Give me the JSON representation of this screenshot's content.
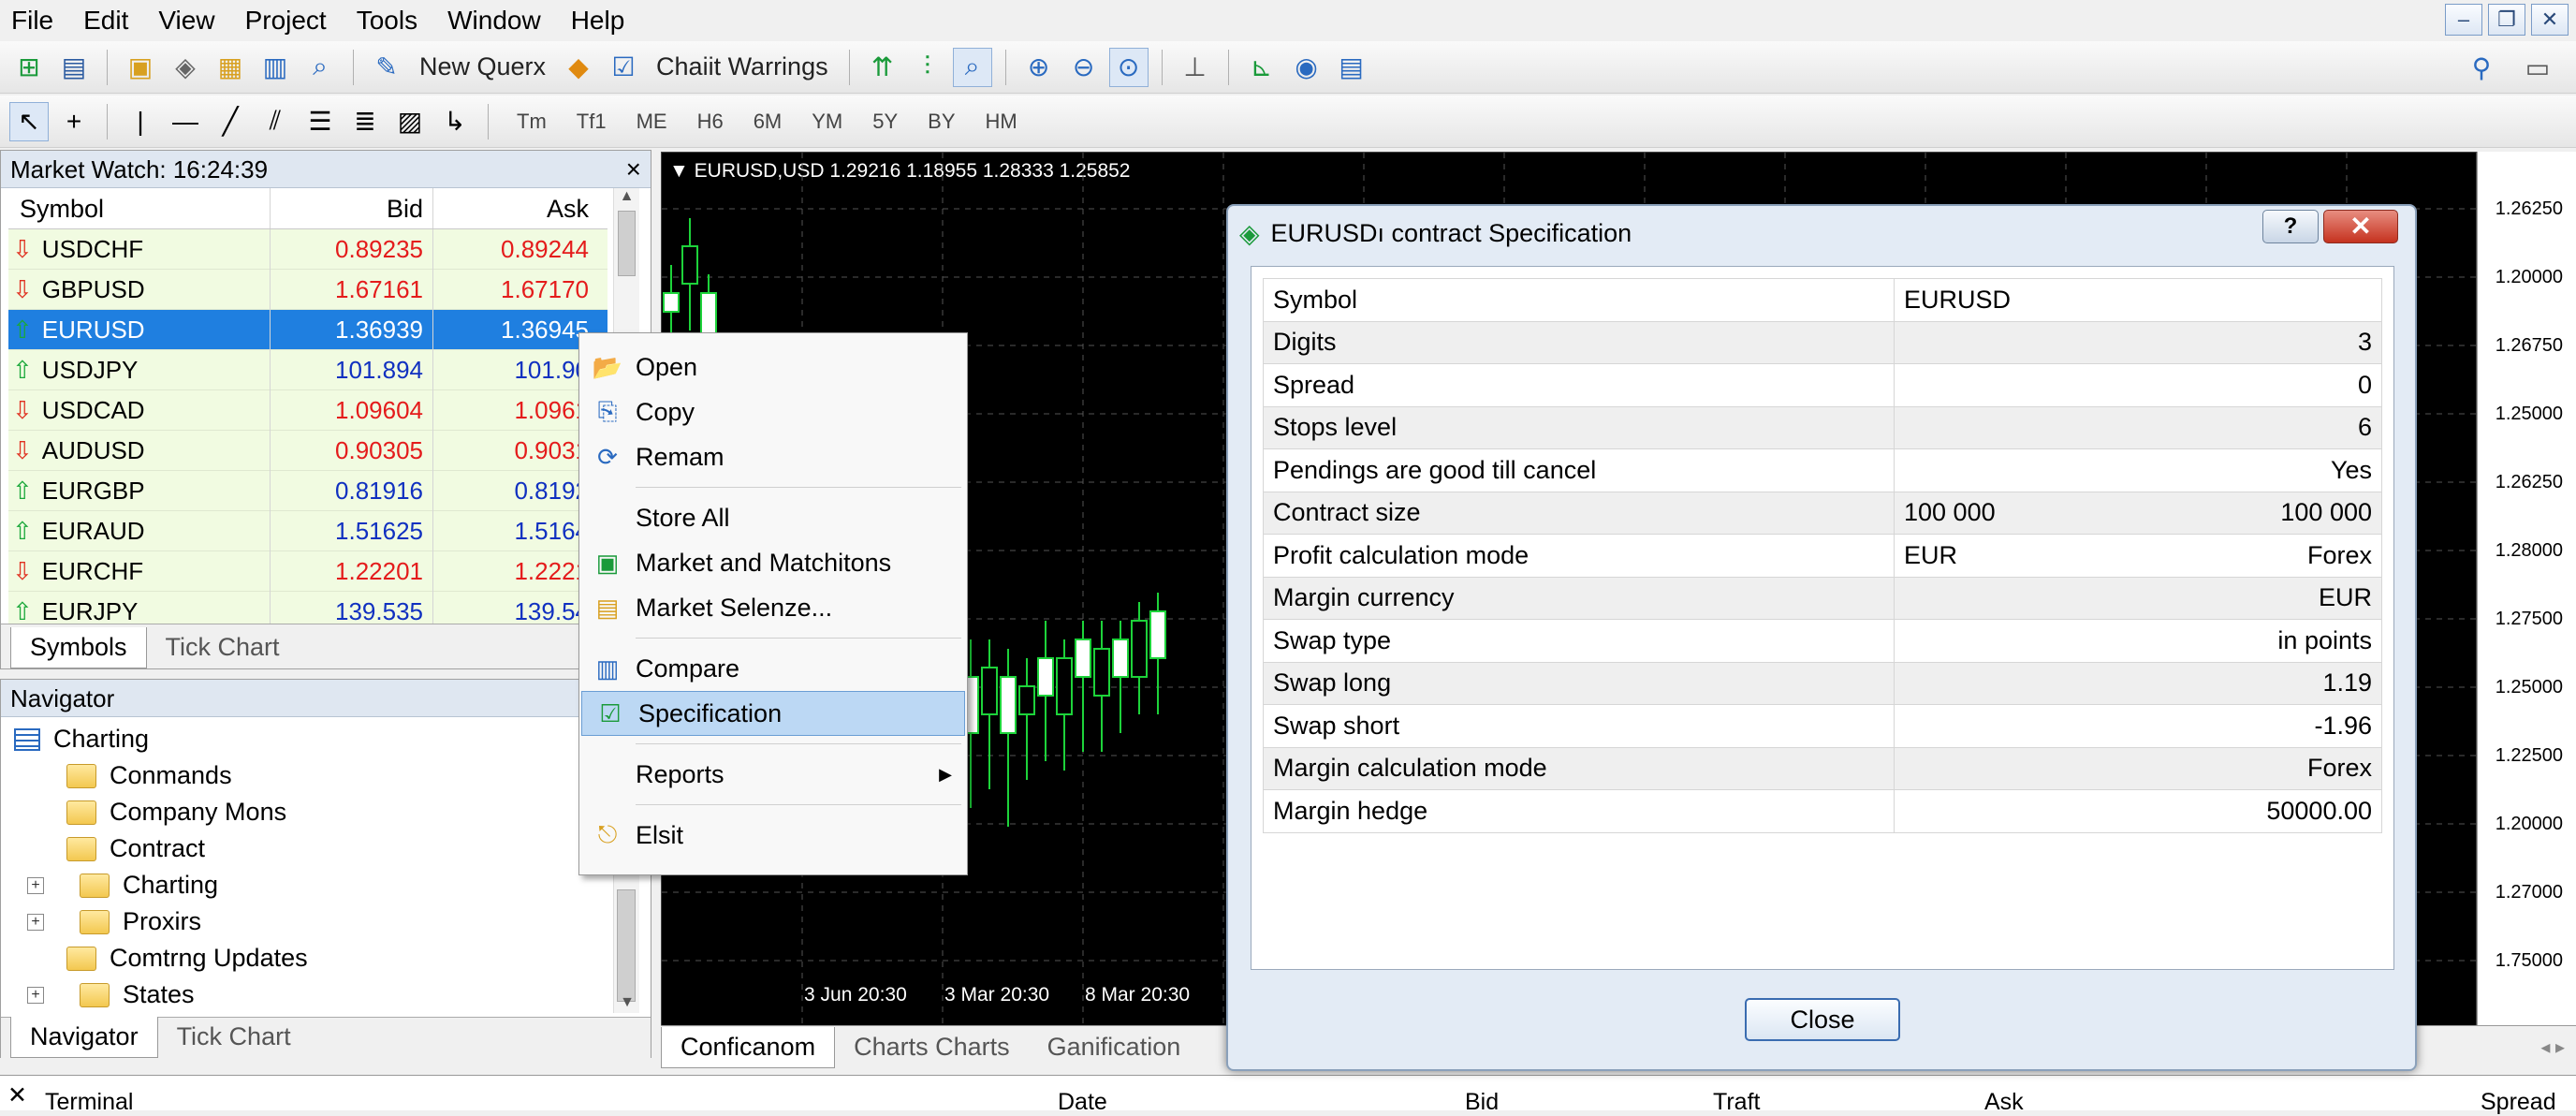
{
  "menubar": {
    "items": [
      "File",
      "Edit",
      "View",
      "Project",
      "Tools",
      "Window",
      "Help"
    ]
  },
  "toolbar1": {
    "new_order": "New Querx",
    "chart_warnings": "Chaiit Warrings"
  },
  "toolbar2": {
    "timeframes": [
      "Tm",
      "Tf1",
      "ME",
      "H6",
      "6M",
      "YM",
      "5Y",
      "BY",
      "HM"
    ]
  },
  "market_watch": {
    "title": "Market Watch: 16:24:39",
    "close": "×",
    "columns": [
      "Symbol",
      "Bid",
      "Ask"
    ],
    "rows": [
      {
        "symbol": "USDCHF",
        "bid": "0.89235",
        "ask": "0.89244",
        "dir": "down",
        "color": "red"
      },
      {
        "symbol": "GBPUSD",
        "bid": "1.67161",
        "ask": "1.67170",
        "dir": "down",
        "color": "red"
      },
      {
        "symbol": "EURUSD",
        "bid": "1.36939",
        "ask": "1.36945",
        "dir": "up",
        "color": "sel"
      },
      {
        "symbol": "USDJPY",
        "bid": "101.894",
        "ask": "101.90",
        "dir": "up",
        "color": "blue"
      },
      {
        "symbol": "USDCAD",
        "bid": "1.09604",
        "ask": "1.0961",
        "dir": "down",
        "color": "red"
      },
      {
        "symbol": "AUDUSD",
        "bid": "0.90305",
        "ask": "0.9031",
        "dir": "down",
        "color": "red"
      },
      {
        "symbol": "EURGBP",
        "bid": "0.81916",
        "ask": "0.8192",
        "dir": "up",
        "color": "blue"
      },
      {
        "symbol": "EURAUD",
        "bid": "1.51625",
        "ask": "1.5164",
        "dir": "up",
        "color": "blue"
      },
      {
        "symbol": "EURCHF",
        "bid": "1.22201",
        "ask": "1.2221",
        "dir": "down",
        "color": "red"
      },
      {
        "symbol": "EURJPY",
        "bid": "139.535",
        "ask": "139.54",
        "dir": "up",
        "color": "blue"
      }
    ],
    "tabs": [
      "Symbols",
      "Tick Chart"
    ]
  },
  "navigator": {
    "title": "Navigator",
    "items": [
      {
        "label": "Charting",
        "level": 0,
        "icon": "chart-list-icon"
      },
      {
        "label": "Conmands",
        "level": 1,
        "icon": "folder-icon"
      },
      {
        "label": "Company Mons",
        "level": 1,
        "icon": "folder-icon"
      },
      {
        "label": "Contract",
        "level": 1,
        "icon": "contract-icon"
      },
      {
        "label": "Charting",
        "level": 1,
        "icon": "chart-icon",
        "expand": true
      },
      {
        "label": "Proxirs",
        "level": 1,
        "icon": "folder-icon",
        "expand": true
      },
      {
        "label": "Comtrng Updates",
        "level": 1,
        "icon": "folder-icon"
      },
      {
        "label": "States",
        "level": 1,
        "icon": "folder-icon",
        "expand": true
      }
    ],
    "tabs": [
      "Navigator",
      "Tick Chart"
    ]
  },
  "chart": {
    "label": "EURUSD,USD",
    "ohlc": "1.29216 1.18955 1.28333 1.25852",
    "price_labels": [
      "1.26250",
      "1.20000",
      "1.26750",
      "1.25000",
      "1.26250",
      "1.28000",
      "1.27500",
      "1.25000",
      "1.22500",
      "1.20000",
      "1.27000",
      "1.75000"
    ],
    "time_labels": [
      "3 Jun 20:30",
      "3 Mar 20:30",
      "8 Mar 20:30"
    ],
    "tabs": [
      "Conficanom",
      "Charts Charts",
      "Ganification"
    ]
  },
  "context_menu": {
    "items": [
      {
        "label": "Open",
        "icon": "folder-open-icon"
      },
      {
        "label": "Copy",
        "icon": "copy-icon"
      },
      {
        "label": "Remam",
        "icon": "refresh-icon"
      },
      {
        "sep": true
      },
      {
        "label": "Store All",
        "icon": ""
      },
      {
        "label": "Market and Matchitons",
        "icon": "market-icon"
      },
      {
        "label": "Market Selenze...",
        "icon": "list-icon"
      },
      {
        "sep": true
      },
      {
        "label": "Compare",
        "icon": "compare-icon"
      },
      {
        "label": "Specification",
        "icon": "spec-icon",
        "selected": true
      },
      {
        "sep": true
      },
      {
        "label": "Reports",
        "icon": "",
        "submenu": true
      },
      {
        "sep": true
      },
      {
        "label": "Elsit",
        "icon": "exit-icon"
      }
    ]
  },
  "dialog": {
    "title": "EURUSDı contract Specification",
    "help": "?",
    "close_x": "✕",
    "rows": [
      {
        "name": "Symbol",
        "left": "EURUSD",
        "value": ""
      },
      {
        "name": "Digits",
        "left": "",
        "value": "3"
      },
      {
        "name": "Spread",
        "left": "",
        "value": "0"
      },
      {
        "name": "Stops level",
        "left": "",
        "value": "6"
      },
      {
        "name": "Pendings are good till cancel",
        "left": "",
        "value": "Yes"
      },
      {
        "name": "Contract size",
        "left": "100 000",
        "value": "100 000"
      },
      {
        "name": "Profit calculation mode",
        "left": "EUR",
        "value": "Forex"
      },
      {
        "name": "Margin currency",
        "left": "",
        "value": "EUR"
      },
      {
        "name": "Swap type",
        "left": "",
        "value": "in points"
      },
      {
        "name": "Swap long",
        "left": "",
        "value": "1.19"
      },
      {
        "name": "Swap short",
        "left": "",
        "value": "-1.96"
      },
      {
        "name": "Margin calculation mode",
        "left": "",
        "value": "Forex"
      },
      {
        "name": "Margin hedge",
        "left": "",
        "value": "50000.00"
      }
    ],
    "close_button": "Close"
  },
  "terminal": {
    "close": "✕",
    "label": "Terminal",
    "columns": [
      "Date",
      "Bid",
      "Traft",
      "Ask",
      "Spread"
    ]
  },
  "colors": {
    "selection": "#1f7fe0",
    "up": "#1aa83a",
    "down": "#e03020",
    "bid_red": "#e41b1b",
    "bid_blue": "#1030c0"
  }
}
